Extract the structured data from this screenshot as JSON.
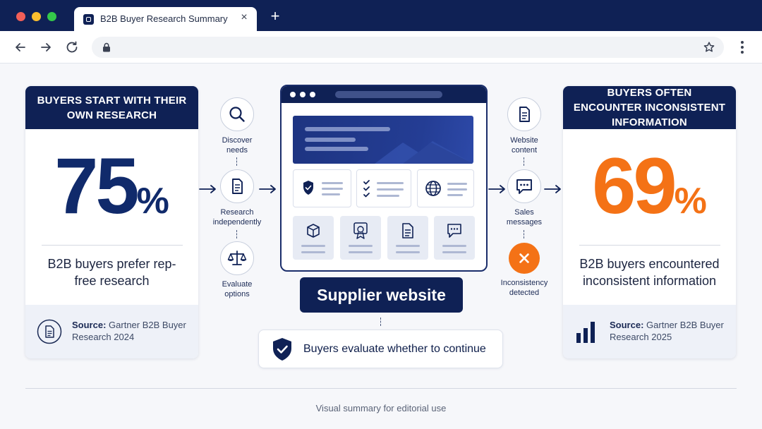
{
  "browser": {
    "tab_title": "B2B Buyer Research Summary",
    "tab_close": "×",
    "new_tab": "+",
    "url": ""
  },
  "left_card": {
    "heading": "BUYERS START WITH THEIR OWN RESEARCH",
    "number": "75",
    "percent": "%",
    "description": "B2B buyers prefer rep-free research",
    "source_label": "Source:",
    "source_text": "Gartner B2B Buyer Research 2024",
    "color": "#102a6b"
  },
  "right_card": {
    "heading": "BUYERS OFTEN ENCOUNTER INCONSISTENT INFORMATION",
    "number": "69",
    "percent": "%",
    "description": "B2B buyers encountered inconsistent information",
    "source_label": "Source:",
    "source_text": "Gartner B2B Buyer Research 2025",
    "color": "#f47216"
  },
  "left_steps": [
    {
      "label": "Discover needs",
      "icon": "search-icon"
    },
    {
      "label": "Research independently",
      "icon": "document-icon"
    },
    {
      "label": "Evaluate options",
      "icon": "scale-icon"
    }
  ],
  "right_steps": [
    {
      "label": "Website content",
      "icon": "document-icon"
    },
    {
      "label": "Sales messages",
      "icon": "chat-icon"
    },
    {
      "label": "Inconsistency detected",
      "icon": "error-x-icon",
      "color": "#f47216"
    }
  ],
  "center": {
    "supplier_label": "Supplier website",
    "evaluate_label": "Buyers evaluate whether to continue"
  },
  "footer": {
    "caption": "Visual summary for editorial use"
  },
  "colors": {
    "navy": "#0f2155",
    "accent_orange": "#f47216",
    "background": "#f6f7fa"
  }
}
